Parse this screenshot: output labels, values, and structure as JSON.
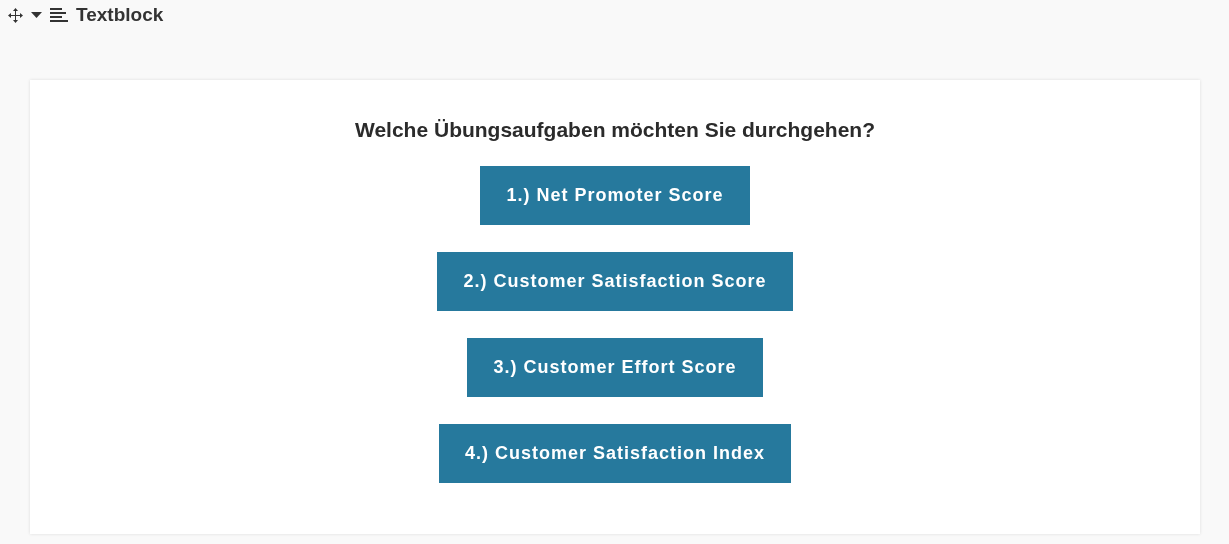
{
  "toolbar": {
    "title": "Textblock"
  },
  "card": {
    "question": "Welche Übungsaufgaben möchten Sie durchgehen?",
    "buttons": [
      "1.) Net Promoter Score",
      "2.) Customer Satisfaction Score",
      "3.) Customer Effort Score",
      "4.) Customer Satisfaction Index"
    ]
  }
}
